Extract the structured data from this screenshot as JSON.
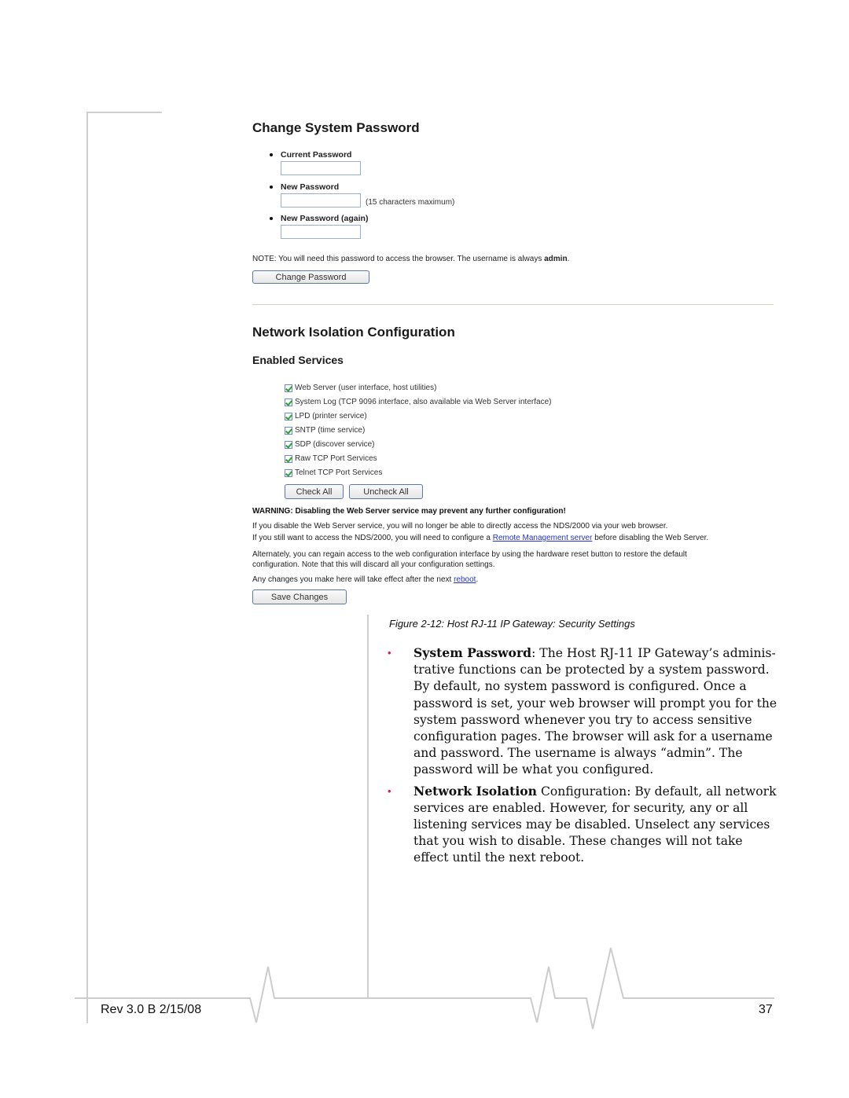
{
  "screenshot": {
    "change_password": {
      "title": "Change System Password",
      "fields": [
        {
          "label": "Current Password",
          "value": "",
          "hint": ""
        },
        {
          "label": "New Password",
          "value": "",
          "hint": "(15 characters maximum)"
        },
        {
          "label": "New Password (again)",
          "value": "",
          "hint": ""
        }
      ],
      "note_prefix": "NOTE: You will need this password to access the browser. The username is always ",
      "note_bold": "admin",
      "note_suffix": ".",
      "button_label": "Change Password"
    },
    "network_isolation": {
      "title": "Network Isolation Configuration",
      "subtitle": "Enabled Services",
      "services": [
        {
          "label": "Web Server (user interface, host utilities)",
          "checked": true
        },
        {
          "label": "System Log (TCP 9096 interface, also available via Web Server interface)",
          "checked": true
        },
        {
          "label": "LPD (printer service)",
          "checked": true
        },
        {
          "label": "SNTP (time service)",
          "checked": true
        },
        {
          "label": "SDP (discover service)",
          "checked": true
        },
        {
          "label": "Raw TCP Port Services",
          "checked": true
        },
        {
          "label": "Telnet TCP Port Services",
          "checked": true
        }
      ],
      "check_all_label": "Check All",
      "uncheck_all_label": "Uncheck All",
      "warning": "WARNING: Disabling the Web Server service may prevent any further configuration!",
      "info_line1": "If you disable the Web Server service, you will no longer be able to directly access the NDS/2000 via your web browser.",
      "info_line2_prefix": "If you still want to access the NDS/2000, you will need to configure a ",
      "info_line2_link": "Remote Management server",
      "info_line2_suffix": " before disabling the Web Server.",
      "alt_line1": "Alternately, you can regain access to the web configuration interface by using the hardware reset button to restore the default",
      "alt_line2": "configuration. Note that this will discard all your configuration settings.",
      "changes_prefix": "Any changes you make here will take effect after the next ",
      "changes_link": "reboot",
      "changes_suffix": ".",
      "save_label": "Save Changes"
    }
  },
  "caption": "Figure 2-12:  Host RJ-11 IP Gateway: Security Settings",
  "body": {
    "items": [
      {
        "bold": "System Password",
        "text": ": The Host RJ-11 IP Gateway’s adminis-trative functions can be protected by a system password. By default, no system password is configured. Once a password is set, your web browser will prompt you for the system password whenever you try to access sensitive configuration pages. The browser will ask for a username and password. The username is always “admin”. The password will be what you configured."
      },
      {
        "bold": "Network Isolation",
        "text": " Configuration: By default, all network services are enabled. However, for security, any or all listening services may be disabled. Unselect any services that you wish to disable. These changes will not take effect until the next reboot."
      }
    ],
    "bullet_color": "#d8194e"
  },
  "footer": {
    "revision": "Rev 3.0 B  2/15/08",
    "page_number": "37"
  }
}
